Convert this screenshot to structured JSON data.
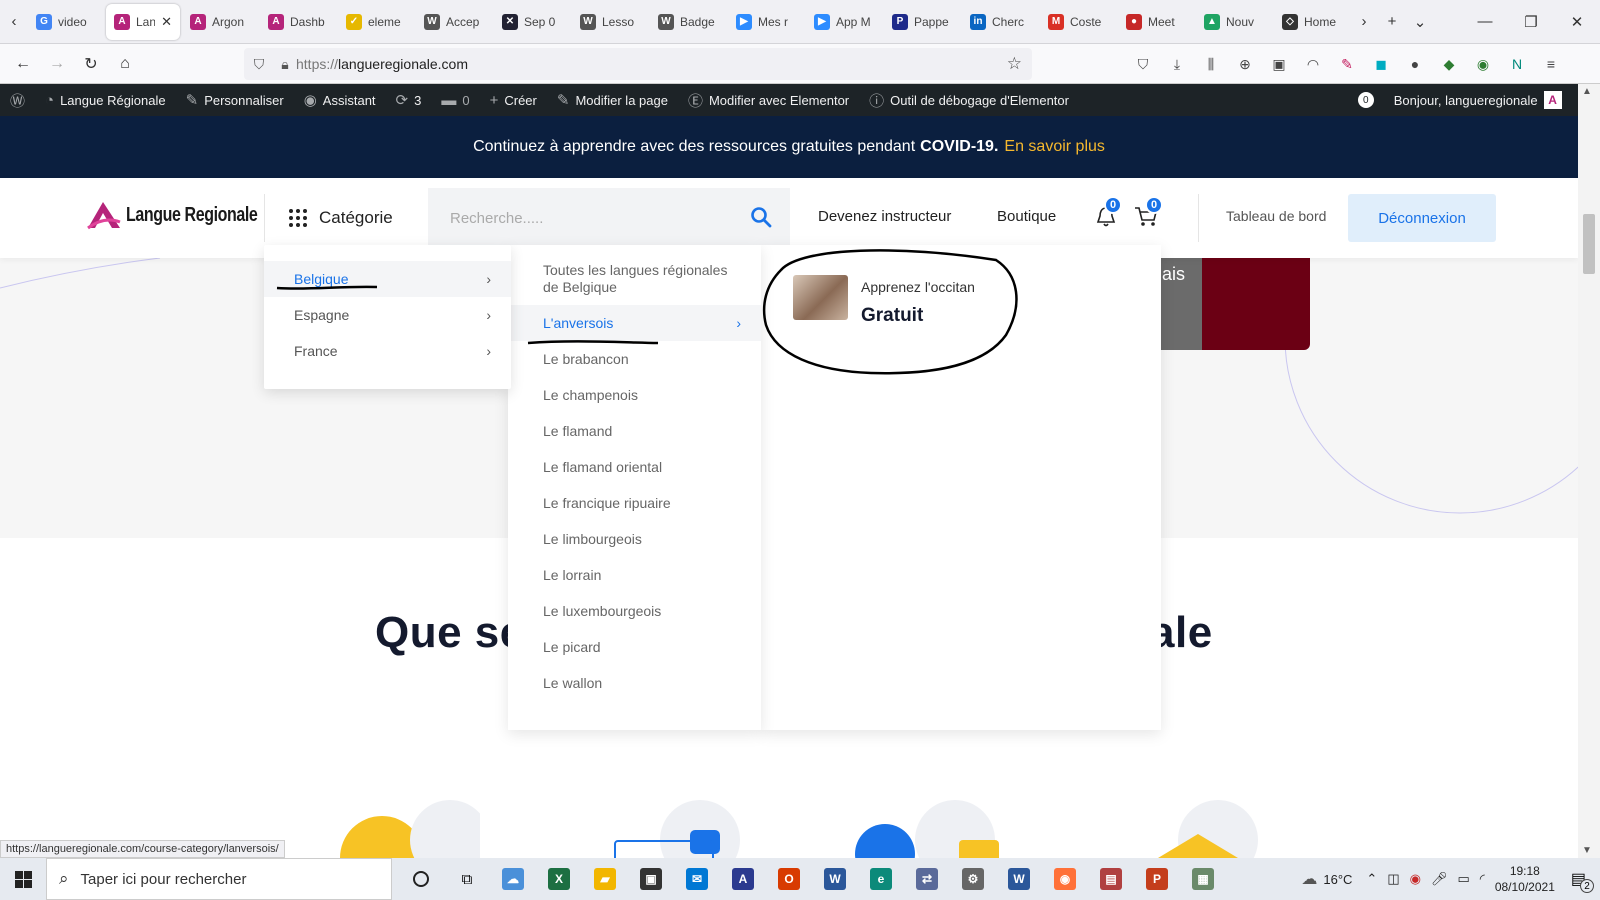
{
  "browser": {
    "tabs": [
      {
        "label": "video",
        "icon": "google-icon",
        "color": "#4285f4",
        "glyph": "G"
      },
      {
        "label": "Lan",
        "icon": "langue-regionale-icon",
        "color": "#b5247a",
        "glyph": "A",
        "active": true
      },
      {
        "label": "Argon",
        "icon": "langue-regionale-icon",
        "color": "#b5247a",
        "glyph": "A"
      },
      {
        "label": "Dashb",
        "icon": "langue-regionale-icon",
        "color": "#b5247a",
        "glyph": "A"
      },
      {
        "label": "eleme",
        "icon": "check-icon",
        "color": "#e6b800",
        "glyph": "✓"
      },
      {
        "label": "Accep",
        "icon": "wordpress-icon",
        "color": "#555",
        "glyph": "W"
      },
      {
        "label": "Sep 0",
        "icon": "x-icon",
        "color": "#223",
        "glyph": "✕"
      },
      {
        "label": "Lesso",
        "icon": "wordpress-icon",
        "color": "#555",
        "glyph": "W"
      },
      {
        "label": "Badge",
        "icon": "wordpress-icon",
        "color": "#555",
        "glyph": "W"
      },
      {
        "label": "Mes r",
        "icon": "zoom-icon",
        "color": "#2d8cff",
        "glyph": "▶"
      },
      {
        "label": "App M",
        "icon": "zoom-icon",
        "color": "#2d8cff",
        "glyph": "▶"
      },
      {
        "label": "Pappe",
        "icon": "p-icon",
        "color": "#1e2a8a",
        "glyph": "P"
      },
      {
        "label": "Cherc",
        "icon": "linkedin-icon",
        "color": "#0a66c2",
        "glyph": "in"
      },
      {
        "label": "Coste",
        "icon": "gmail-icon",
        "color": "#d93025",
        "glyph": "M"
      },
      {
        "label": "Meet",
        "icon": "microphone-icon",
        "color": "#c62828",
        "glyph": "●"
      },
      {
        "label": "Nouv",
        "icon": "drive-icon",
        "color": "#1fa463",
        "glyph": "▲"
      },
      {
        "label": "Home",
        "icon": "home-icon",
        "color": "#333",
        "glyph": "◇"
      }
    ],
    "url_prefix": "https://",
    "url_host": "langueregionale.com",
    "status_url": "https://langueregionale.com/course-category/lanversois/"
  },
  "wpbar": {
    "site": "Langue Régionale",
    "customize": "Personnaliser",
    "assistant": "Assistant",
    "updates": "3",
    "comments": "0",
    "create": "Créer",
    "edit_page": "Modifier la page",
    "elementor": "Modifier avec Elementor",
    "debug": "Outil de débogage d'Elementor",
    "notif_count": "0",
    "greeting": "Bonjour, langueregionale"
  },
  "banner": {
    "text": "Continuez à apprendre avec des ressources gratuites pendant",
    "bold": "COVID-19.",
    "link": "En savoir plus"
  },
  "header": {
    "logo": "Langue Regionale",
    "category": "Catégorie",
    "search_placeholder": "Recherche.....",
    "become_instructor": "Devenez instructeur",
    "shop": "Boutique",
    "notif_badge": "0",
    "cart_badge": "0",
    "dashboard": "Tableau de bord",
    "logout": "Déconnexion"
  },
  "menu": {
    "countries": [
      "Belgique",
      "Espagne",
      "France"
    ],
    "languages": [
      "Toutes les langues régionales de Belgique",
      "L'anversois",
      "Le brabancon",
      "Le champenois",
      "Le flamand",
      "Le flamand oriental",
      "Le francique ripuaire",
      "Le limbourgeois",
      "Le lorrain",
      "Le luxembourgeois",
      "Le picard",
      "Le wallon"
    ],
    "course_title": "Apprenez l'occitan",
    "course_price": "Gratuit"
  },
  "page": {
    "title_left": "Que se",
    "title_right": "ale",
    "card_text": "ais"
  },
  "taskbar": {
    "search_placeholder": "Taper ici pour rechercher",
    "temperature": "16°C",
    "time": "19:18",
    "date": "08/10/2021",
    "notif_count": "2"
  },
  "colors": {
    "accent": "#1a73e8",
    "banner_bg": "#0b1f3f",
    "banner_link": "#f5b82e",
    "brand": "#b5247a"
  }
}
